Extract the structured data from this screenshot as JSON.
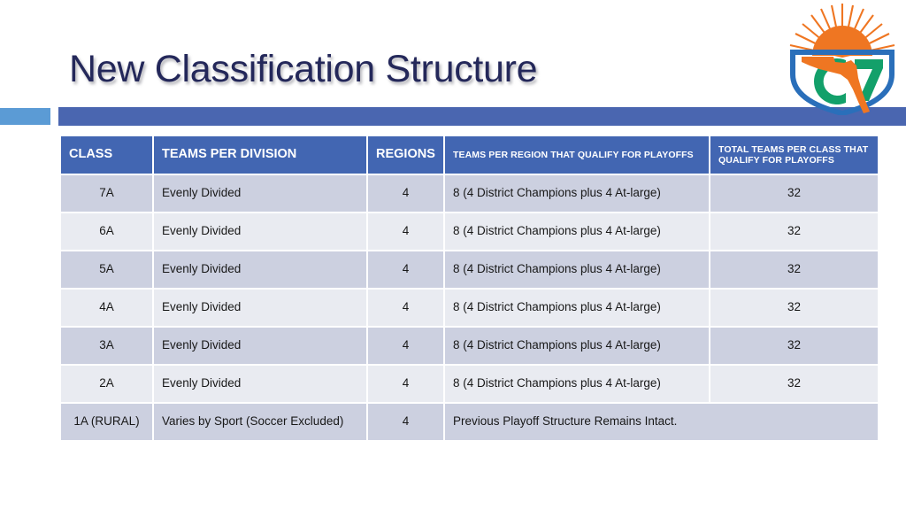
{
  "slide": {
    "title": "New Classification Structure"
  },
  "logo": {
    "name": "fhsaa-logo",
    "colors": {
      "sun": "#ef7622",
      "shield": "#2a6fba",
      "green": "#13a06a",
      "state": "#ef7622"
    }
  },
  "theme": {
    "accent_light": "#5b9bd5",
    "accent_bar": "#4a66b0",
    "header_bg": "#4266b2",
    "row_odd": "#ccd0e0",
    "row_even": "#e9ebf1",
    "title_color": "#24285a"
  },
  "table": {
    "headers": [
      "CLASS",
      "TEAMS PER DIVISION",
      "REGIONS",
      "TEAMS PER REGION THAT QUALIFY FOR PLAYOFFS",
      "TOTAL TEAMS PER CLASS THAT QUALIFY FOR PLAYOFFS"
    ],
    "rows": [
      {
        "class": "7A",
        "teams_per_division": "Evenly Divided",
        "regions": "4",
        "teams_per_region": "8 (4 District Champions plus 4 At-large)",
        "total_teams": "32",
        "merged": false
      },
      {
        "class": "6A",
        "teams_per_division": "Evenly Divided",
        "regions": "4",
        "teams_per_region": "8 (4 District Champions plus 4 At-large)",
        "total_teams": "32",
        "merged": false
      },
      {
        "class": "5A",
        "teams_per_division": "Evenly Divided",
        "regions": "4",
        "teams_per_region": "8 (4 District Champions plus 4 At-large)",
        "total_teams": "32",
        "merged": false
      },
      {
        "class": "4A",
        "teams_per_division": "Evenly Divided",
        "regions": "4",
        "teams_per_region": "8 (4 District Champions plus 4 At-large)",
        "total_teams": "32",
        "merged": false
      },
      {
        "class": "3A",
        "teams_per_division": "Evenly Divided",
        "regions": "4",
        "teams_per_region": "8 (4 District Champions plus 4 At-large)",
        "total_teams": "32",
        "merged": false
      },
      {
        "class": "2A",
        "teams_per_division": "Evenly Divided",
        "regions": "4",
        "teams_per_region": "8 (4 District Champions plus 4 At-large)",
        "total_teams": "32",
        "merged": false
      },
      {
        "class": "1A (RURAL)",
        "teams_per_division": "Varies by Sport (Soccer Excluded)",
        "regions": "4",
        "merged_text": "Previous Playoff Structure Remains Intact.",
        "merged": true
      }
    ]
  }
}
